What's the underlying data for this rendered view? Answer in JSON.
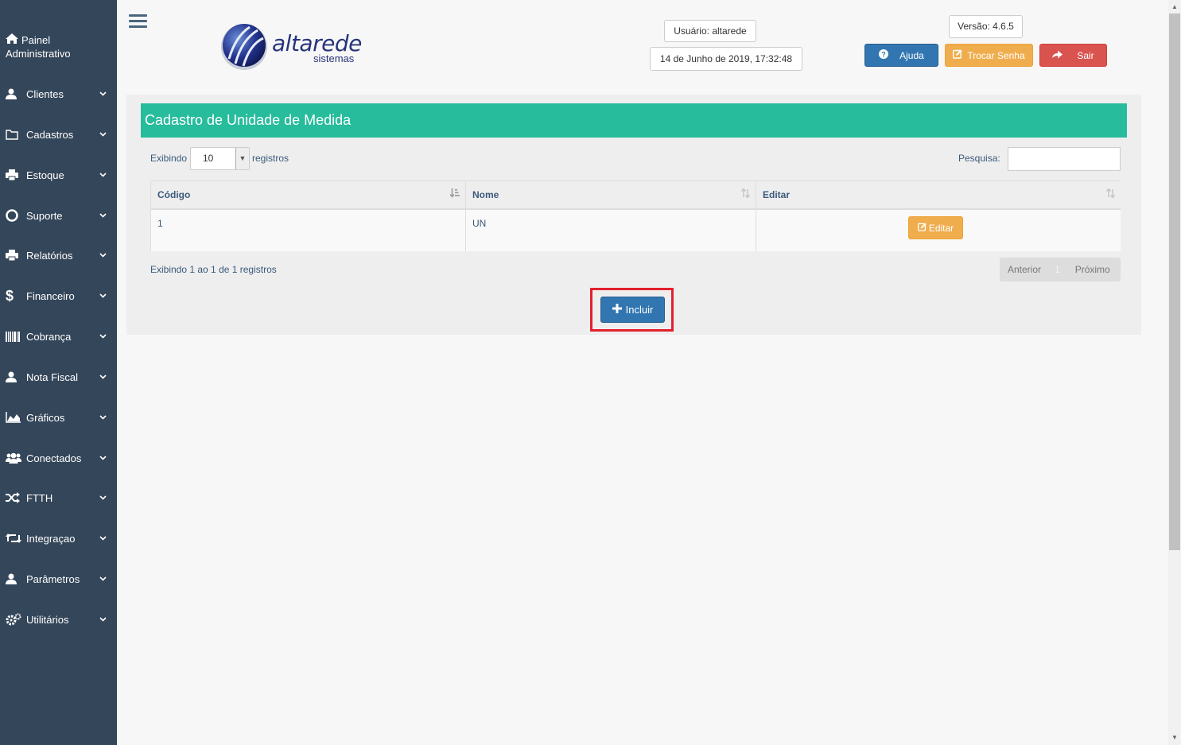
{
  "sidebar": {
    "home": {
      "icon": "home-icon",
      "label": "Painel Administrativo"
    },
    "items": [
      {
        "key": "clientes",
        "label": "Clientes",
        "icon": "user-icon"
      },
      {
        "key": "cadastros",
        "label": "Cadastros",
        "icon": "folder-icon"
      },
      {
        "key": "estoque",
        "label": "Estoque",
        "icon": "printer-icon"
      },
      {
        "key": "suporte",
        "label": "Suporte",
        "icon": "lifebuoy-icon"
      },
      {
        "key": "relatorios",
        "label": "Relatórios",
        "icon": "printer-icon"
      },
      {
        "key": "financeiro",
        "label": "Financeiro",
        "icon": "dollar-icon"
      },
      {
        "key": "cobranca",
        "label": "Cobrança",
        "icon": "barcode-icon"
      },
      {
        "key": "nota-fiscal",
        "label": "Nota Fiscal",
        "icon": "user-icon"
      },
      {
        "key": "graficos",
        "label": "Gráficos",
        "icon": "area-chart-icon"
      },
      {
        "key": "conectados",
        "label": "Conectados",
        "icon": "users-icon"
      },
      {
        "key": "ftth",
        "label": "FTTH",
        "icon": "shuffle-icon"
      },
      {
        "key": "integracao",
        "label": "Integraçao",
        "icon": "retweet-icon"
      },
      {
        "key": "parametros",
        "label": "Parâmetros",
        "icon": "user-icon"
      },
      {
        "key": "utilitarios",
        "label": "Utilitários",
        "icon": "gears-icon"
      }
    ]
  },
  "logo": {
    "brand": "altarede",
    "sub": "sistemas"
  },
  "header": {
    "user": "Usuário: altarede",
    "datetime": "14 de Junho de 2019, 17:32:48",
    "version": "Versão: 4.6.5",
    "help_label": "Ajuda",
    "change_password_label": "Trocar Senha",
    "exit_label": "Sair"
  },
  "panel": {
    "title": "Cadastro de Unidade de Medida",
    "show_prefix": "Exibindo",
    "show_value": "10",
    "show_suffix": "registros",
    "search_label": "Pesquisa:",
    "search_value": "",
    "table": {
      "columns": [
        "Código",
        "Nome",
        "Editar"
      ],
      "rows": [
        {
          "codigo": "1",
          "nome": "UN",
          "edit_label": "Editar"
        }
      ]
    },
    "info": "Exibindo 1 ao 1 de 1 registros",
    "pager": {
      "prev": "Anterior",
      "page": "1",
      "next": "Próximo"
    },
    "include_label": "Incluir"
  },
  "colors": {
    "sidebar": "#34465a",
    "header_green": "#26bc9c",
    "primary": "#3276b1",
    "warning": "#f0ad4e",
    "danger": "#d9534f",
    "highlight": "#e2202b"
  }
}
